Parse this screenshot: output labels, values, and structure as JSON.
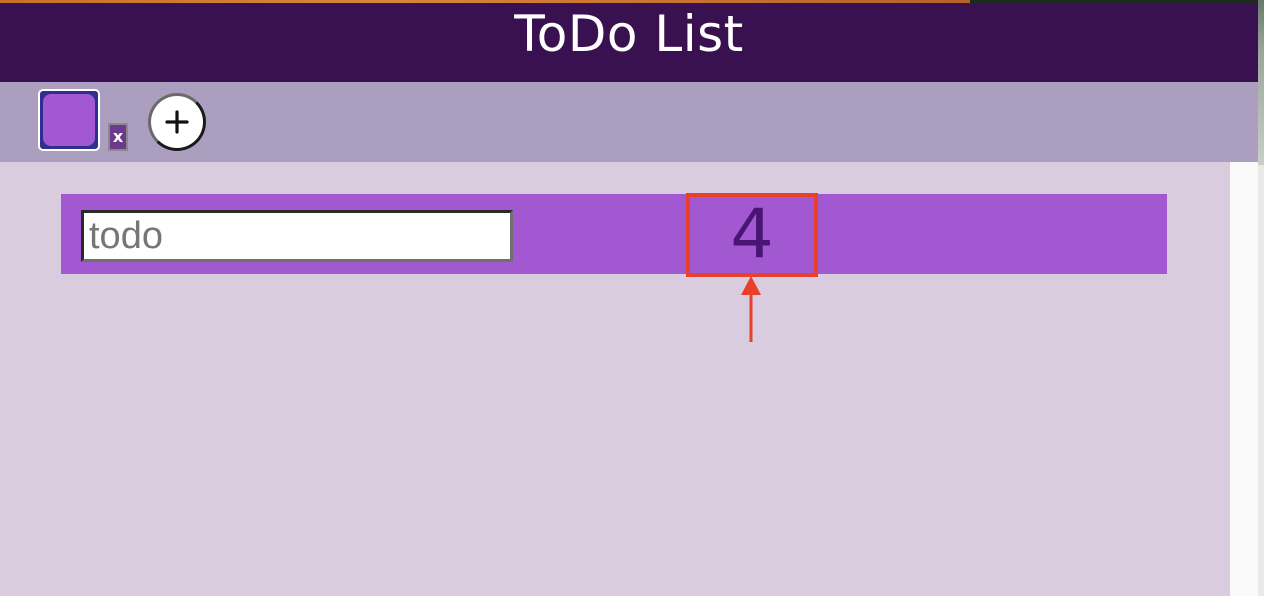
{
  "header": {
    "title": "ToDo List"
  },
  "toolbar": {
    "swatch_color": "#a158d0",
    "delete_label": "x",
    "add_icon": "plus-circle-icon"
  },
  "todo": {
    "input_value": "",
    "input_placeholder": "todo",
    "count": "4",
    "row_color": "#a158d0"
  },
  "annotation": {
    "highlight_color": "#e8402a",
    "target": "todo-count"
  },
  "colors": {
    "header_bg": "#3a1150",
    "toolbar_bg": "#ab9ebf",
    "content_bg": "#d9ccdf"
  }
}
